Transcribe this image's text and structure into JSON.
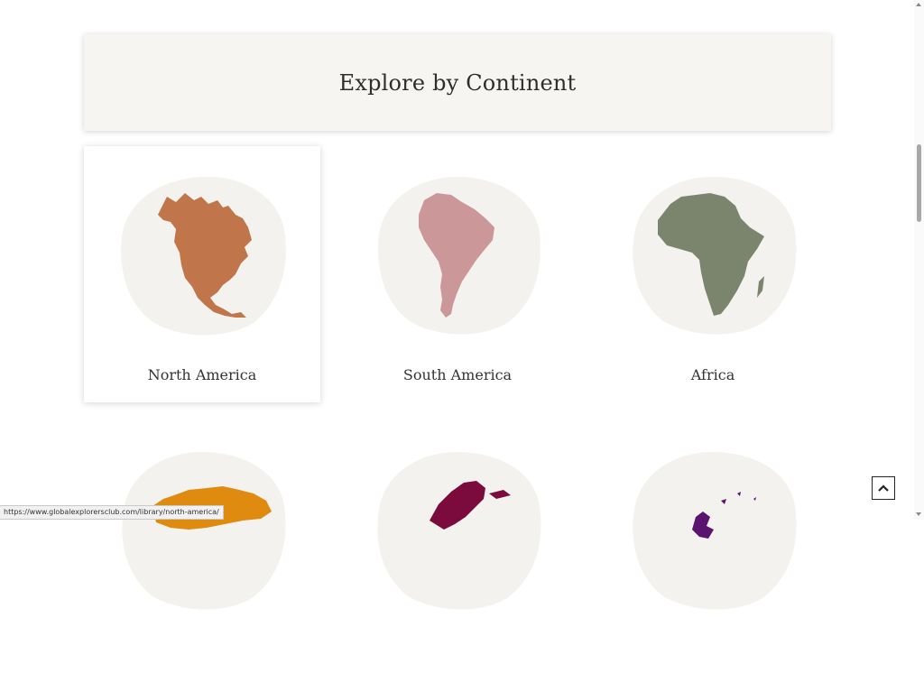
{
  "section": {
    "title": "Explore by Continent"
  },
  "continents": [
    {
      "label": "North America",
      "color": "#c0764a",
      "icon": "north-america-map-icon"
    },
    {
      "label": "South America",
      "color": "#cc9798",
      "icon": "south-america-map-icon"
    },
    {
      "label": "Africa",
      "color": "#7b856d",
      "icon": "africa-map-icon"
    },
    {
      "label": "",
      "color": "#de8b10",
      "icon": "asia-map-icon"
    },
    {
      "label": "",
      "color": "#7b0b3c",
      "icon": "europe-map-icon"
    },
    {
      "label": "",
      "color": "#5a1470",
      "icon": "oceania-map-icon"
    }
  ],
  "colors": {
    "blob": "#f4f2ee",
    "header_bg": "#f6f5f2"
  },
  "status_url": "https://www.globalexplorersclub.com/library/north-america/",
  "back_to_top": {
    "icon": "chevron-up-icon"
  }
}
